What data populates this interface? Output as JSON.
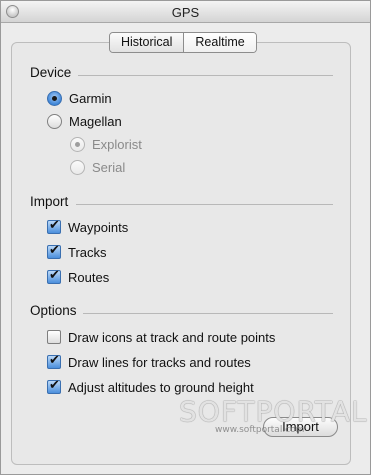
{
  "window": {
    "title": "GPS"
  },
  "tabs": [
    {
      "label": "Historical",
      "selected": true
    },
    {
      "label": "Realtime",
      "selected": false
    }
  ],
  "device": {
    "title": "Device",
    "options": [
      {
        "label": "Garmin",
        "checked": true,
        "enabled": true
      },
      {
        "label": "Magellan",
        "checked": false,
        "enabled": true
      }
    ],
    "magellan_suboptions": [
      {
        "label": "Explorist",
        "checked": true,
        "enabled": false
      },
      {
        "label": "Serial",
        "checked": false,
        "enabled": false
      }
    ]
  },
  "import": {
    "title": "Import",
    "items": [
      {
        "label": "Waypoints",
        "checked": true
      },
      {
        "label": "Tracks",
        "checked": true
      },
      {
        "label": "Routes",
        "checked": true
      }
    ]
  },
  "options": {
    "title": "Options",
    "items": [
      {
        "label": "Draw icons at track and route points",
        "checked": false
      },
      {
        "label": "Draw lines for tracks and routes",
        "checked": true
      },
      {
        "label": "Adjust altitudes to ground height",
        "checked": true
      }
    ]
  },
  "actions": {
    "import_label": "Import"
  },
  "watermark": {
    "main": "SOFTPORTAL",
    "sub": "www.softportal.com"
  }
}
